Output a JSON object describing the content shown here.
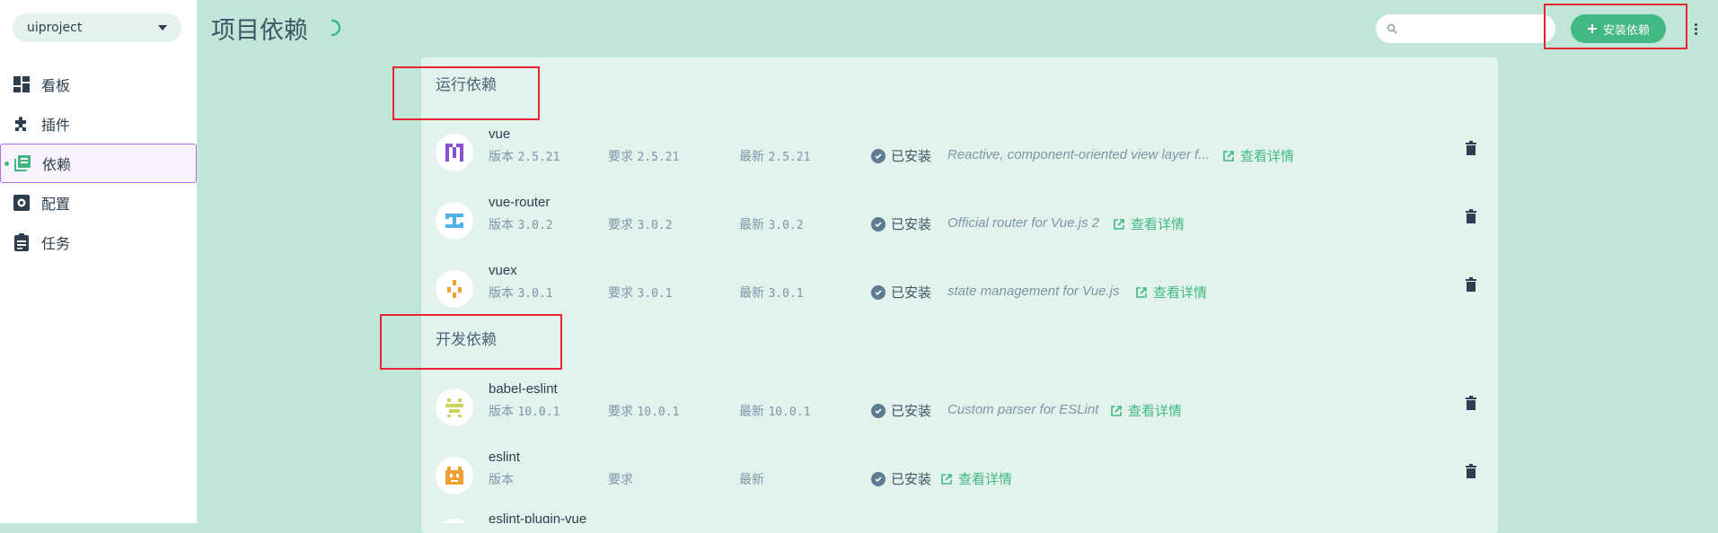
{
  "sidebar": {
    "project": "uiproject",
    "items": [
      {
        "label": "看板",
        "icon": "dashboard-icon"
      },
      {
        "label": "插件",
        "icon": "puzzle-icon"
      },
      {
        "label": "依赖",
        "icon": "library-icon"
      },
      {
        "label": "配置",
        "icon": "settings-icon"
      },
      {
        "label": "任务",
        "icon": "clipboard-icon"
      }
    ]
  },
  "header": {
    "title": "项目依赖",
    "search_placeholder": "",
    "install_label": "安装依赖"
  },
  "sections": {
    "runtime_title": "运行依赖",
    "dev_title": "开发依赖"
  },
  "labels": {
    "version": "版本",
    "wanted": "要求",
    "latest": "最新",
    "installed": "已安装",
    "details": "查看详情"
  },
  "dependencies": [
    {
      "name": "vue",
      "version": "2.5.21",
      "wanted": "2.5.21",
      "latest": "2.5.21",
      "description": "Reactive, component-oriented view layer f..."
    },
    {
      "name": "vue-router",
      "version": "3.0.2",
      "wanted": "3.0.2",
      "latest": "3.0.2",
      "description": "Official router for Vue.js 2"
    },
    {
      "name": "vuex",
      "version": "3.0.1",
      "wanted": "3.0.1",
      "latest": "3.0.1",
      "description": "state management for Vue.js"
    },
    {
      "name": "babel-eslint",
      "version": "10.0.1",
      "wanted": "10.0.1",
      "latest": "10.0.1",
      "description": "Custom parser for ESLint"
    },
    {
      "name": "eslint",
      "version": "",
      "wanted": "",
      "latest": "",
      "description": ""
    },
    {
      "name": "eslint-plugin-vue",
      "version": "",
      "wanted": "",
      "latest": "",
      "description": ""
    }
  ],
  "colors": {
    "accent": "#42b983",
    "background": "#bfe6d8",
    "panel": "#e1f3ec",
    "annotation": "#e8262e"
  }
}
